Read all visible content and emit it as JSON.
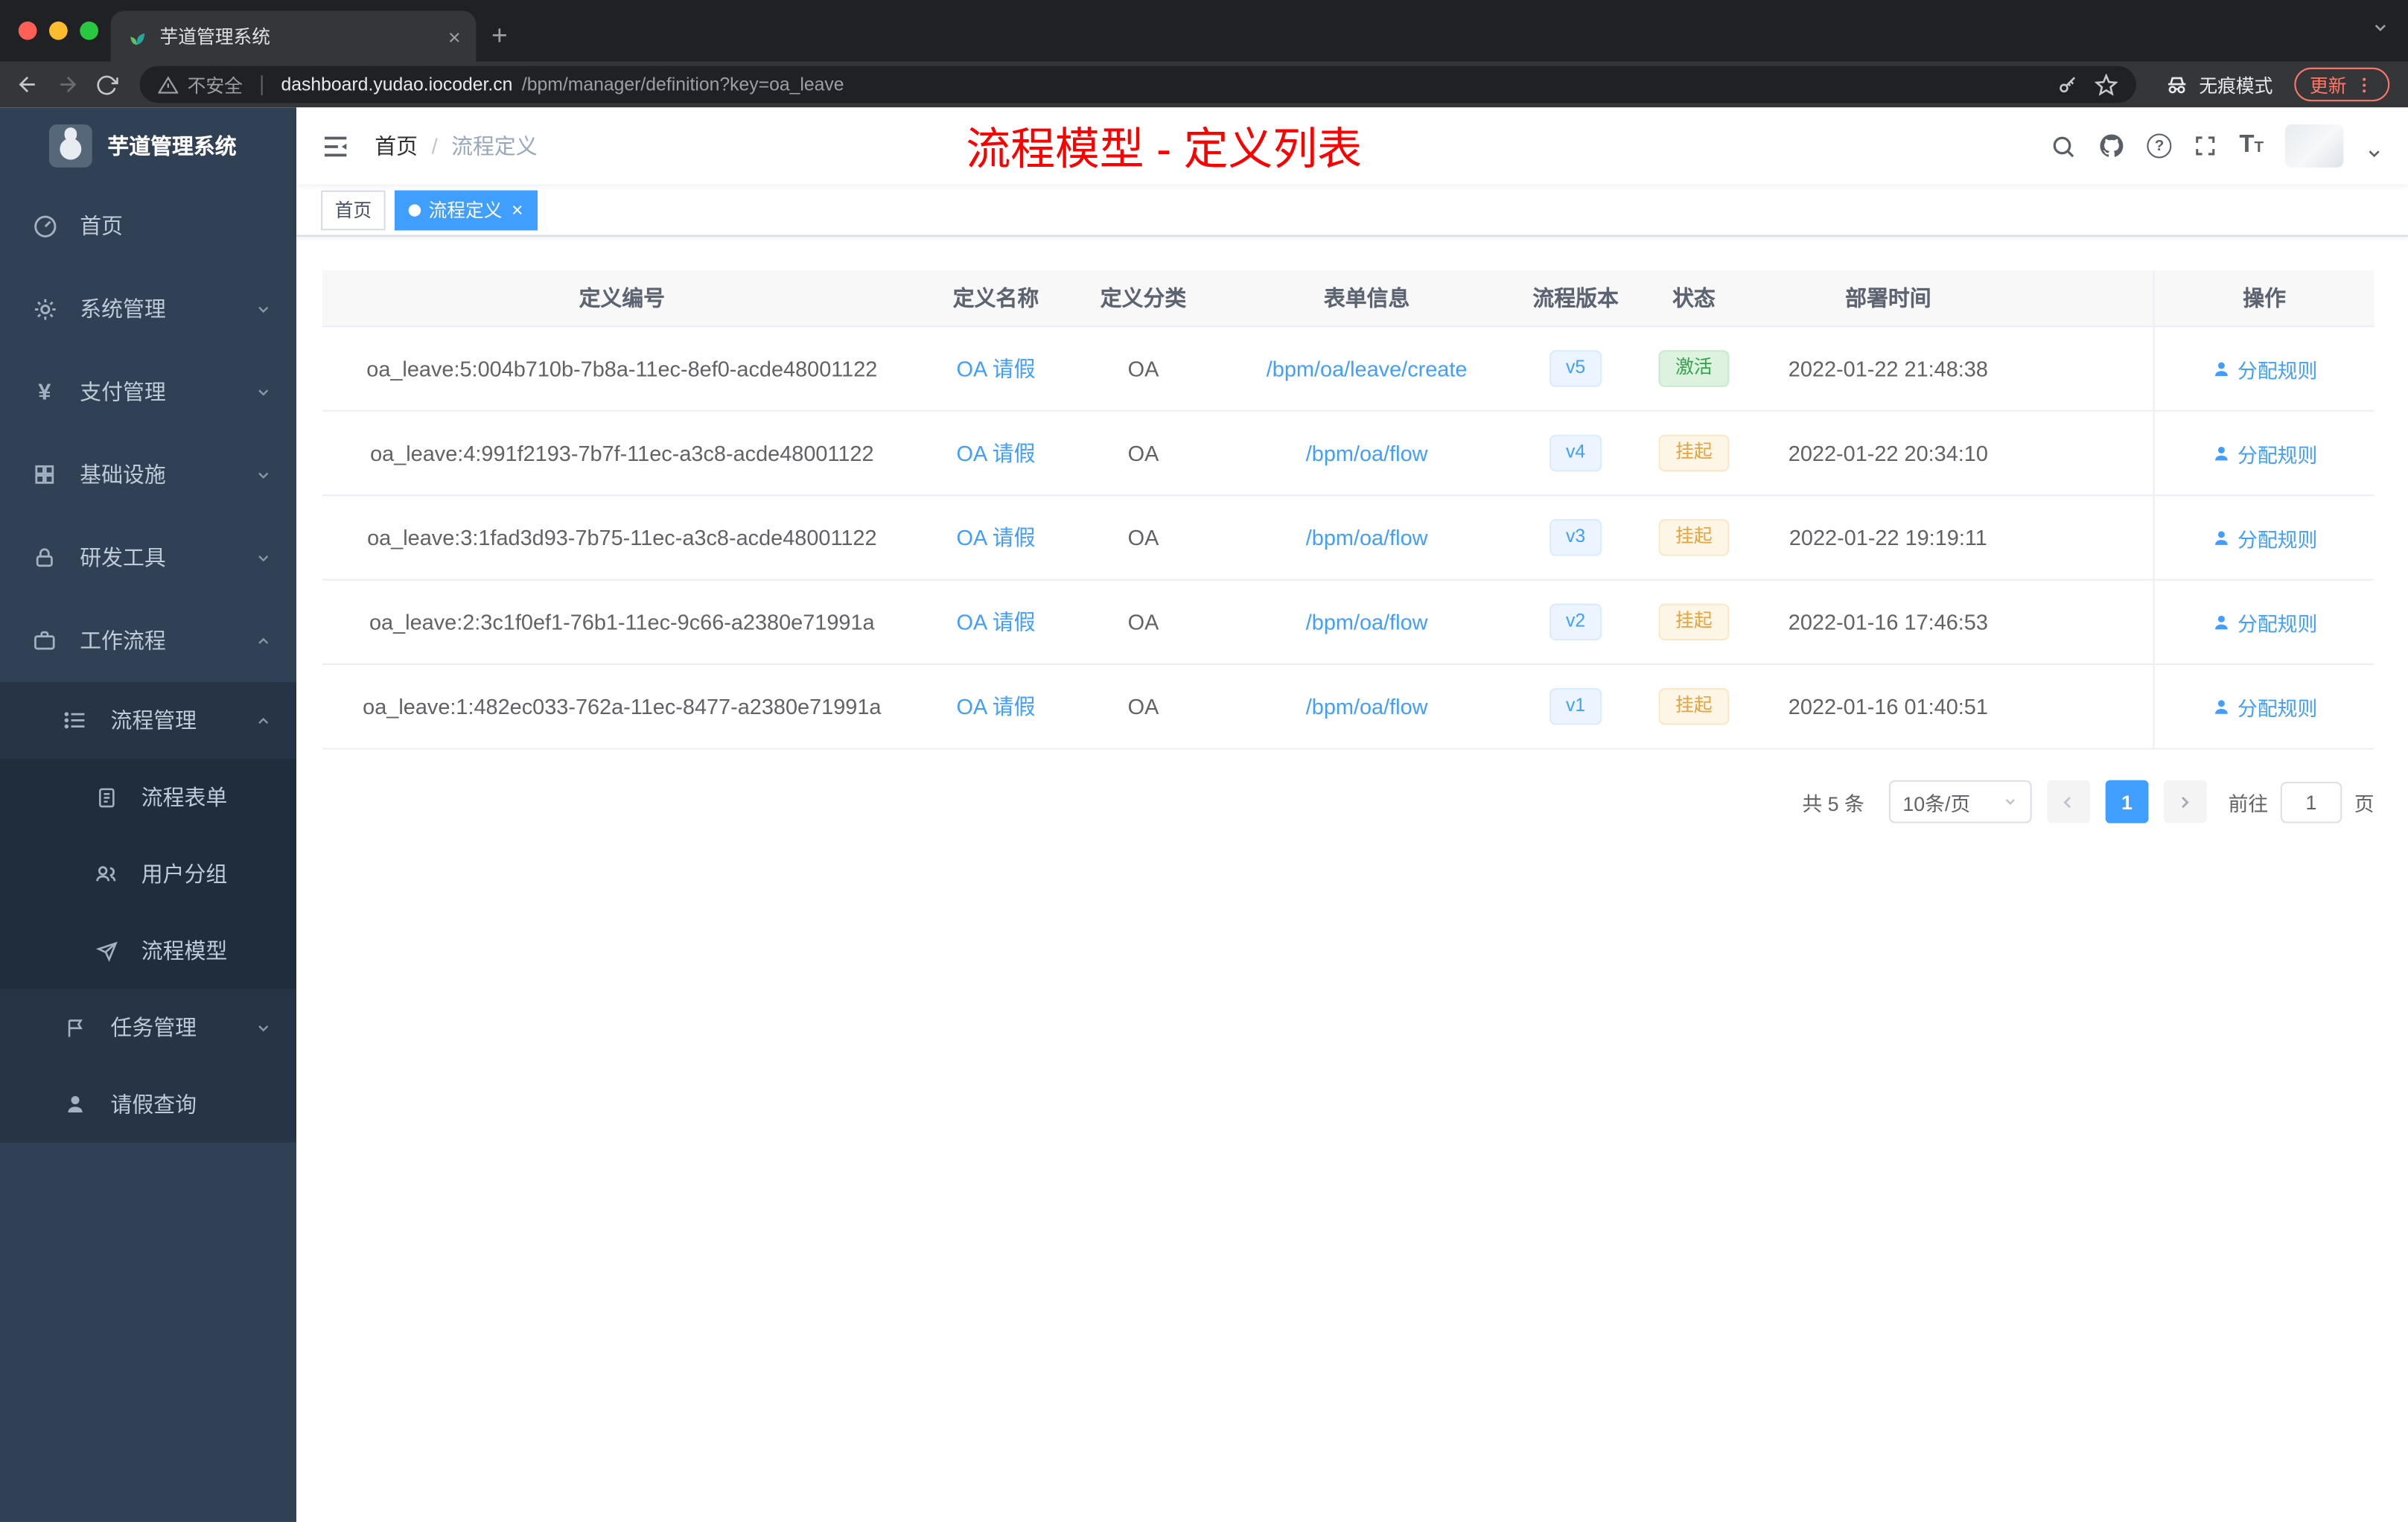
{
  "browser": {
    "tab_title": "芋道管理系统",
    "security_label": "不安全",
    "url_host": "dashboard.yudao.iocoder.cn",
    "url_path": "/bpm/manager/definition?key=oa_leave",
    "incognito_label": "无痕模式",
    "update_label": "更新"
  },
  "icons": {
    "close": "×",
    "plus": "+",
    "yen": "¥",
    "question": "?",
    "font_size": "T"
  },
  "sidebar": {
    "logo_title": "芋道管理系统",
    "items": [
      {
        "label": "首页"
      },
      {
        "label": "系统管理"
      },
      {
        "label": "支付管理"
      },
      {
        "label": "基础设施"
      },
      {
        "label": "研发工具"
      },
      {
        "label": "工作流程"
      },
      {
        "label": "流程管理"
      },
      {
        "label": "流程表单"
      },
      {
        "label": "用户分组"
      },
      {
        "label": "流程模型"
      },
      {
        "label": "任务管理"
      },
      {
        "label": "请假查询"
      }
    ]
  },
  "header": {
    "breadcrumb_home": "首页",
    "breadcrumb_sep": "/",
    "breadcrumb_current": "流程定义",
    "annotation": "流程模型 - 定义列表"
  },
  "tags": {
    "home": "首页",
    "active": "流程定义"
  },
  "table": {
    "headers": {
      "id": "定义编号",
      "name": "定义名称",
      "category": "定义分类",
      "form": "表单信息",
      "version": "流程版本",
      "status": "状态",
      "deploy_time": "部署时间",
      "action": "操作"
    },
    "action_label": "分配规则",
    "rows": [
      {
        "id": "oa_leave:5:004b710b-7b8a-11ec-8ef0-acde48001122",
        "name": "OA 请假",
        "category": "OA",
        "form": "/bpm/oa/leave/create",
        "version": "v5",
        "status": "激活",
        "time": "2022-01-22 21:48:38"
      },
      {
        "id": "oa_leave:4:991f2193-7b7f-11ec-a3c8-acde48001122",
        "name": "OA 请假",
        "category": "OA",
        "form": "/bpm/oa/flow",
        "version": "v4",
        "status": "挂起",
        "time": "2022-01-22 20:34:10"
      },
      {
        "id": "oa_leave:3:1fad3d93-7b75-11ec-a3c8-acde48001122",
        "name": "OA 请假",
        "category": "OA",
        "form": "/bpm/oa/flow",
        "version": "v3",
        "status": "挂起",
        "time": "2022-01-22 19:19:11"
      },
      {
        "id": "oa_leave:2:3c1f0ef1-76b1-11ec-9c66-a2380e71991a",
        "name": "OA 请假",
        "category": "OA",
        "form": "/bpm/oa/flow",
        "version": "v2",
        "status": "挂起",
        "time": "2022-01-16 17:46:53"
      },
      {
        "id": "oa_leave:1:482ec033-762a-11ec-8477-a2380e71991a",
        "name": "OA 请假",
        "category": "OA",
        "form": "/bpm/oa/flow",
        "version": "v1",
        "status": "挂起",
        "time": "2022-01-16 01:40:51"
      }
    ]
  },
  "pagination": {
    "total": "共 5 条",
    "page_size": "10条/页",
    "current_page": "1",
    "goto_label": "前往",
    "goto_value": "1",
    "unit_label": "页"
  },
  "colors": {
    "accent": "#409eff",
    "annotation": "#fd0000",
    "success": "#32a14b",
    "warning": "#e6a23c",
    "sidebar_bg": "#304156"
  }
}
